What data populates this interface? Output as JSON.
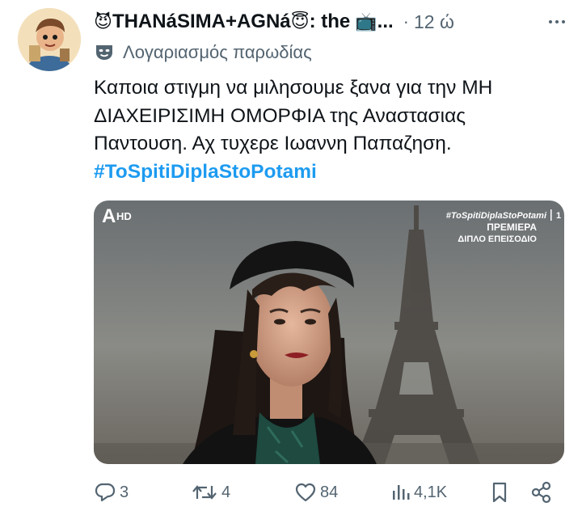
{
  "tweet": {
    "display_name": "THANáSIMA+AGNá",
    "display_name_tail": ": the",
    "emoji_devil": "😈",
    "emoji_angel": "😇",
    "emoji_tv": "📺",
    "ellipsis": "...",
    "time_separator": "·",
    "time": "12 ώ",
    "parody_label": "Λογαριασμός παρωδίας",
    "text_lines": [
      "Καποια στιγμη να μιλησουμε ξανα για την ΜΗ",
      "ΔΙΑΧΕΙΡΙΣΙΜΗ ΟΜΟΡΦΙΑ της Αναστασιας",
      "Παντουση. Αχ τυχερε Ιωαννη Παπαζηση."
    ],
    "hashtag": "#ToSpitiDiplaStoPotami"
  },
  "media": {
    "channel_logo": "A",
    "hd_label": "HD",
    "overlay_hashtag": "#ToSpitiDiplaStoPotami",
    "overlay_channel_digit": "1",
    "premiere_label": "ΠΡΕΜΙΕΡΑ",
    "episode_label": "ΔΙΠΛΟ ΕΠΕΙΣΟΔΙΟ"
  },
  "actions": {
    "reply_count": "3",
    "repost_count": "4",
    "like_count": "84",
    "views_count": "4,1K"
  },
  "icons": {
    "more": "more-horizontal-icon",
    "parody": "theater-mask-icon",
    "reply": "reply-icon",
    "repost": "repost-icon",
    "like": "heart-icon",
    "views": "views-icon",
    "bookmark": "bookmark-icon",
    "share": "share-icon"
  },
  "colors": {
    "text": "#0f1419",
    "muted": "#536471",
    "link": "#1d9bf0"
  }
}
